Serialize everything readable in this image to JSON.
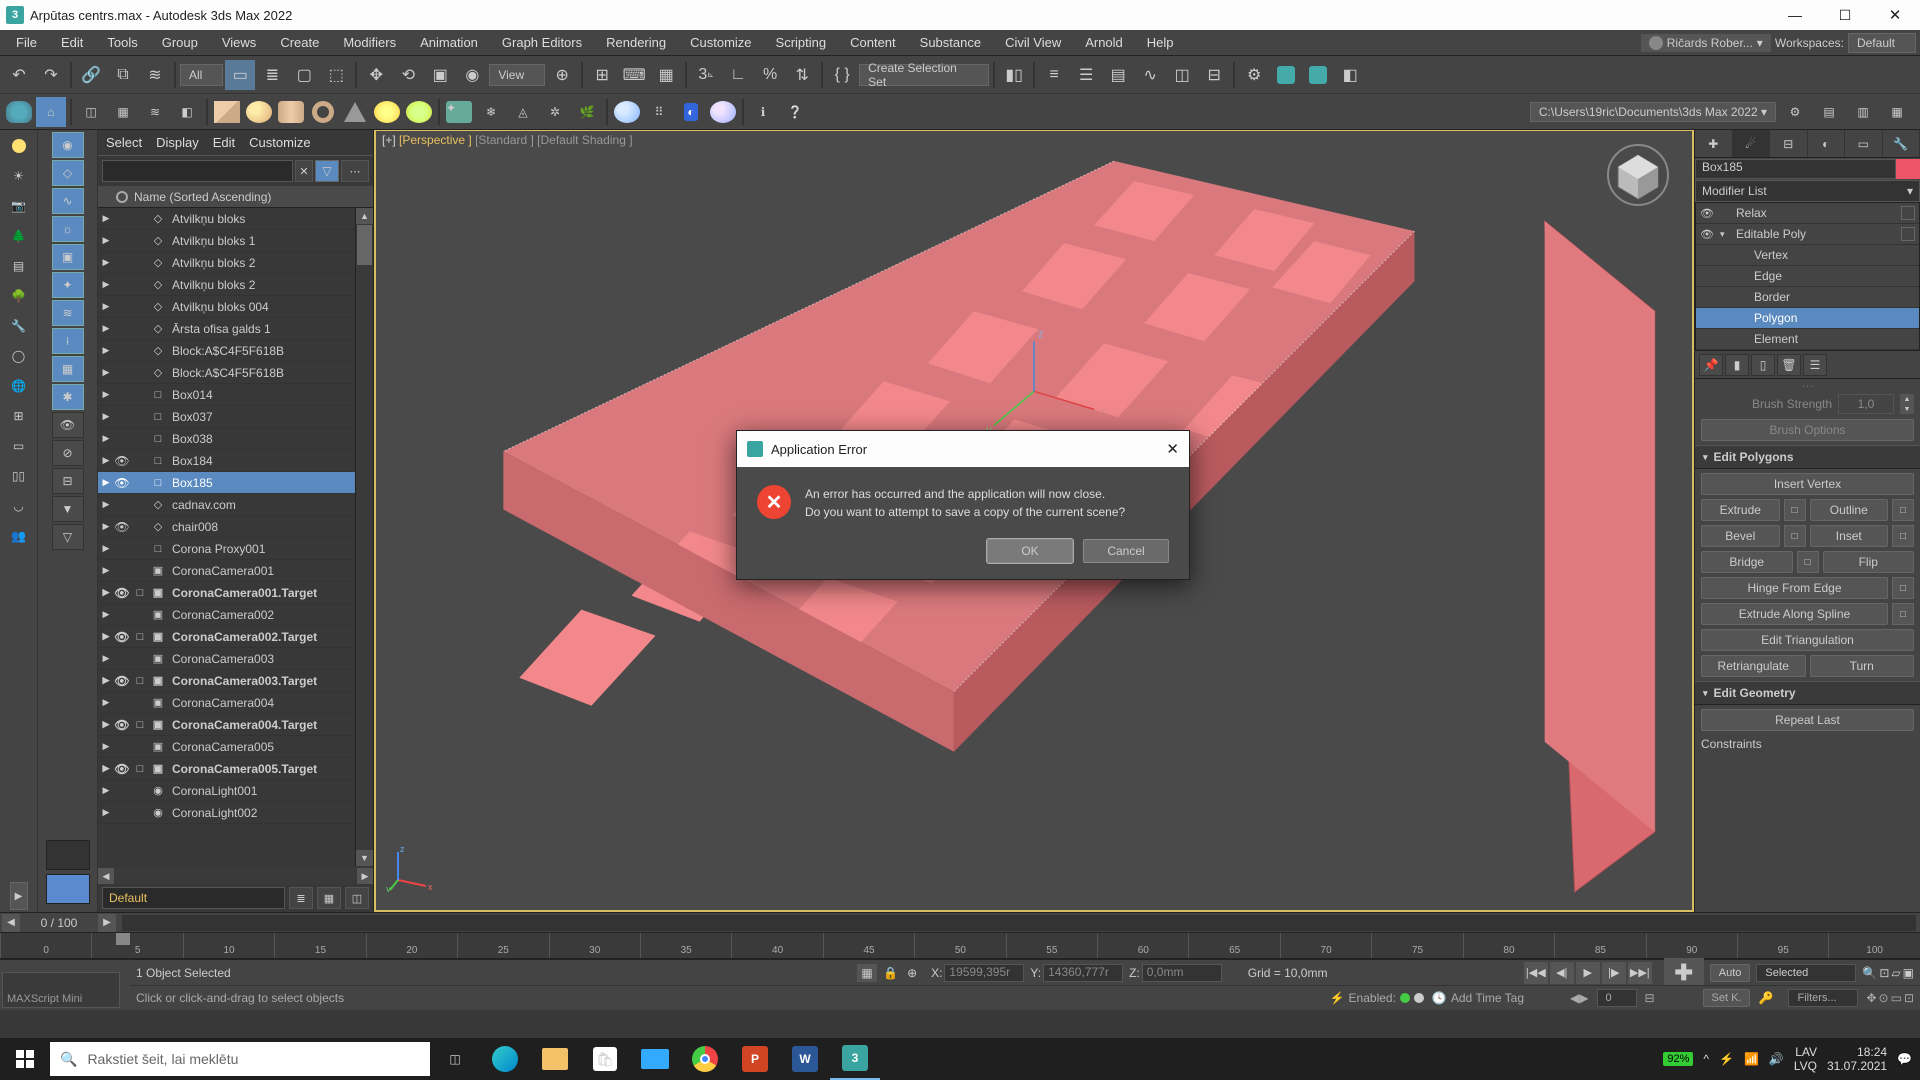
{
  "titlebar": {
    "text": "Arpūtas centrs.max - Autodesk 3ds Max 2022"
  },
  "menu": {
    "items": [
      "File",
      "Edit",
      "Tools",
      "Group",
      "Views",
      "Create",
      "Modifiers",
      "Animation",
      "Graph Editors",
      "Rendering",
      "Customize",
      "Scripting",
      "Content",
      "Substance",
      "Civil View",
      "Arnold",
      "Help"
    ],
    "user": "Ričards Rober...",
    "workspaces_label": "Workspaces:",
    "workspace": "Default"
  },
  "toolbar1": {
    "filter": "All",
    "view": "View",
    "selset": "Create Selection Set"
  },
  "project_path": "C:\\Users\\19ric\\Documents\\3ds Max 2022",
  "explorer": {
    "tabs": [
      "Select",
      "Display",
      "Edit",
      "Customize"
    ],
    "header": "Name (Sorted Ascending)",
    "items": [
      {
        "name": "Atvilkņu bloks",
        "icon": "◇"
      },
      {
        "name": "Atvilkņu bloks 1",
        "icon": "◇"
      },
      {
        "name": "Atvilkņu bloks 2",
        "icon": "◇"
      },
      {
        "name": "Atvilkņu bloks 2",
        "icon": "◇"
      },
      {
        "name": "Atvilkņu bloks 004",
        "icon": "◇"
      },
      {
        "name": "Ārsta ofisa galds 1",
        "icon": "◇"
      },
      {
        "name": "Block:A$C4F5F618B",
        "icon": "◇"
      },
      {
        "name": "Block:A$C4F5F618B",
        "icon": "◇"
      },
      {
        "name": "Box014",
        "icon": "□"
      },
      {
        "name": "Box037",
        "icon": "□"
      },
      {
        "name": "Box038",
        "icon": "□"
      },
      {
        "name": "Box184",
        "icon": "□",
        "eye": true
      },
      {
        "name": "Box185",
        "icon": "□",
        "eye": true,
        "sel": true
      },
      {
        "name": "cadnav.com",
        "icon": "◇"
      },
      {
        "name": "chair008",
        "icon": "◇",
        "eye": true
      },
      {
        "name": "Corona Proxy001",
        "icon": "□"
      },
      {
        "name": "CoronaCamera001",
        "icon": "▣"
      },
      {
        "name": "CoronaCamera001.Target",
        "icon": "▣",
        "eye": true,
        "target": true,
        "bold": true
      },
      {
        "name": "CoronaCamera002",
        "icon": "▣"
      },
      {
        "name": "CoronaCamera002.Target",
        "icon": "▣",
        "eye": true,
        "target": true,
        "bold": true
      },
      {
        "name": "CoronaCamera003",
        "icon": "▣"
      },
      {
        "name": "CoronaCamera003.Target",
        "icon": "▣",
        "eye": true,
        "target": true,
        "bold": true
      },
      {
        "name": "CoronaCamera004",
        "icon": "▣"
      },
      {
        "name": "CoronaCamera004.Target",
        "icon": "▣",
        "eye": true,
        "target": true,
        "bold": true
      },
      {
        "name": "CoronaCamera005",
        "icon": "▣"
      },
      {
        "name": "CoronaCamera005.Target",
        "icon": "▣",
        "eye": true,
        "target": true,
        "bold": true
      },
      {
        "name": "CoronaLight001",
        "icon": "◉"
      },
      {
        "name": "CoronaLight002",
        "icon": "◉"
      }
    ],
    "material": "Default"
  },
  "viewport": {
    "label_plus": "[+]",
    "label_persp": "[Perspective ]",
    "label_std": "[Standard ]",
    "label_shade": "[Default Shading ]"
  },
  "cmdpanel": {
    "objname": "Box185",
    "modlist": "Modifier List",
    "stack": [
      {
        "name": "Relax",
        "oo": "👁"
      },
      {
        "name": "Editable Poly",
        "caret": "▾",
        "oo": "👁"
      },
      {
        "name": "Vertex",
        "sub": true
      },
      {
        "name": "Edge",
        "sub": true
      },
      {
        "name": "Border",
        "sub": true
      },
      {
        "name": "Polygon",
        "sub": true,
        "sel": true
      },
      {
        "name": "Element",
        "sub": true
      }
    ],
    "brush_strength_label": "Brush Strength",
    "brush_strength": "1,0",
    "brush_options": "Brush Options",
    "roll_editpoly": "Edit Polygons",
    "insert_vertex": "Insert Vertex",
    "extrude": "Extrude",
    "outline": "Outline",
    "bevel": "Bevel",
    "inset": "Inset",
    "bridge": "Bridge",
    "flip": "Flip",
    "hinge": "Hinge From Edge",
    "extrude_spline": "Extrude Along Spline",
    "edit_tri": "Edit Triangulation",
    "retri": "Retriangulate",
    "turn": "Turn",
    "roll_editgeo": "Edit Geometry",
    "repeat_last": "Repeat Last",
    "constraints": "Constraints"
  },
  "trackbar": {
    "pos": "0 / 100",
    "ticks": [
      "0",
      "5",
      "10",
      "15",
      "20",
      "25",
      "30",
      "35",
      "40",
      "45",
      "50",
      "55",
      "60",
      "65",
      "70",
      "75",
      "80",
      "85",
      "90",
      "95",
      "100"
    ]
  },
  "status": {
    "maxscript": "MAXScript Mini",
    "selinfo": "1 Object Selected",
    "prompt": "Click or click-and-drag to select objects",
    "x_lbl": "X:",
    "x": "19599,395r",
    "y_lbl": "Y:",
    "y": "14360,777r",
    "z_lbl": "Z:",
    "z": "0,0mm",
    "grid": "Grid = 10,0mm",
    "enabled": "Enabled:",
    "addtag": "Add Time Tag",
    "framefield": "0",
    "auto": "Auto",
    "setk": "Set K.",
    "selected": "Selected",
    "filters": "Filters..."
  },
  "dialog": {
    "title": "Application Error",
    "line1": "An error has occurred and the application will now close.",
    "line2": "Do you want to attempt to save a copy of the current scene?",
    "ok": "OK",
    "cancel": "Cancel"
  },
  "taskbar": {
    "search_placeholder": "Rakstiet šeit, lai meklētu",
    "battery": "92%",
    "lang1": "LAV",
    "lang2": "LVQ",
    "time": "18:24",
    "date": "31.07.2021"
  }
}
